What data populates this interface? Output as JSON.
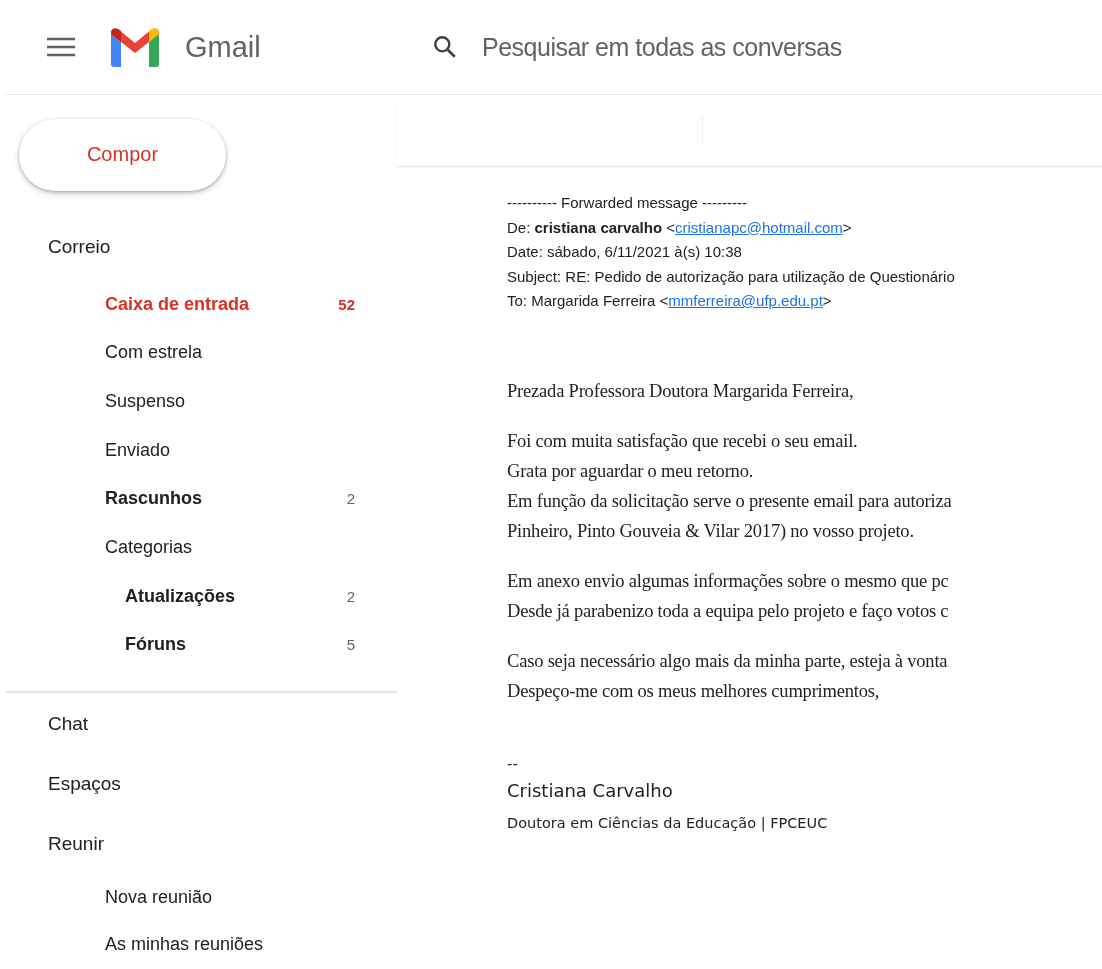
{
  "header": {
    "app_name": "Gmail",
    "search": {
      "placeholder": "Pesquisar em todas as conversas"
    }
  },
  "compose": {
    "label": "Compor"
  },
  "mail": {
    "title": "Correio",
    "items": [
      {
        "label": "Caixa de entrada",
        "count": "52",
        "selected": true,
        "unread": true
      },
      {
        "label": "Com estrela",
        "selected": false,
        "unread": false
      },
      {
        "label": "Suspenso",
        "selected": false,
        "unread": false
      },
      {
        "label": "Enviado",
        "selected": false,
        "unread": false
      },
      {
        "label": "Rascunhos",
        "count": "2",
        "selected": false,
        "unread": true
      },
      {
        "label": "Categorias",
        "selected": false,
        "unread": false,
        "children": [
          {
            "label": "Atualizações",
            "count": "2",
            "selected": false,
            "unread": true
          },
          {
            "label": "Fóruns",
            "count": "5",
            "selected": false,
            "unread": true
          }
        ]
      }
    ]
  },
  "sections": [
    {
      "title": "Chat"
    },
    {
      "title": "Espaços"
    },
    {
      "title": "Reunir",
      "items": [
        "Nova reunião",
        "As minhas reuniões"
      ]
    }
  ],
  "message": {
    "forwarded": "---------- Forwarded message ---------",
    "from": {
      "label": "De:",
      "name": "cristiana carvalho",
      "open": "<",
      "email": "cristianapc@hotmail.com",
      "close": ">"
    },
    "date": "Date: sábado, 6/11/2021 à(s) 10:38",
    "subject": "Subject: RE: Pedido de autorização para utilização de Questionário",
    "to": {
      "label": "To:",
      "name": "Margarida Ferreira",
      "open": "<",
      "email": "mmferreira@ufp.edu.pt",
      "close": ">"
    },
    "paragraphs": [
      [
        "Prezada Professora Doutora Margarida Ferreira,"
      ],
      [
        "Foi com muita satisfação que recebi o seu email.",
        "Grata por aguardar o meu retorno.",
        "Em função da solicitação serve o presente email para autoriza",
        "Pinheiro, Pinto Gouveia & Vilar 2017) no vosso projeto."
      ],
      [
        "Em anexo envio algumas informações sobre o mesmo que pc",
        "Desde já parabenizo toda a equipa pelo projeto e faço votos c"
      ],
      [
        "Caso seja necessário algo mais da minha parte, esteja à vonta",
        "Despeço-me com os meus melhores cumprimentos,"
      ]
    ],
    "signature": {
      "dashes": "--",
      "name": "Cristiana Carvalho",
      "title": "Doutora em Ciências da Educação | FPCEUC"
    }
  }
}
